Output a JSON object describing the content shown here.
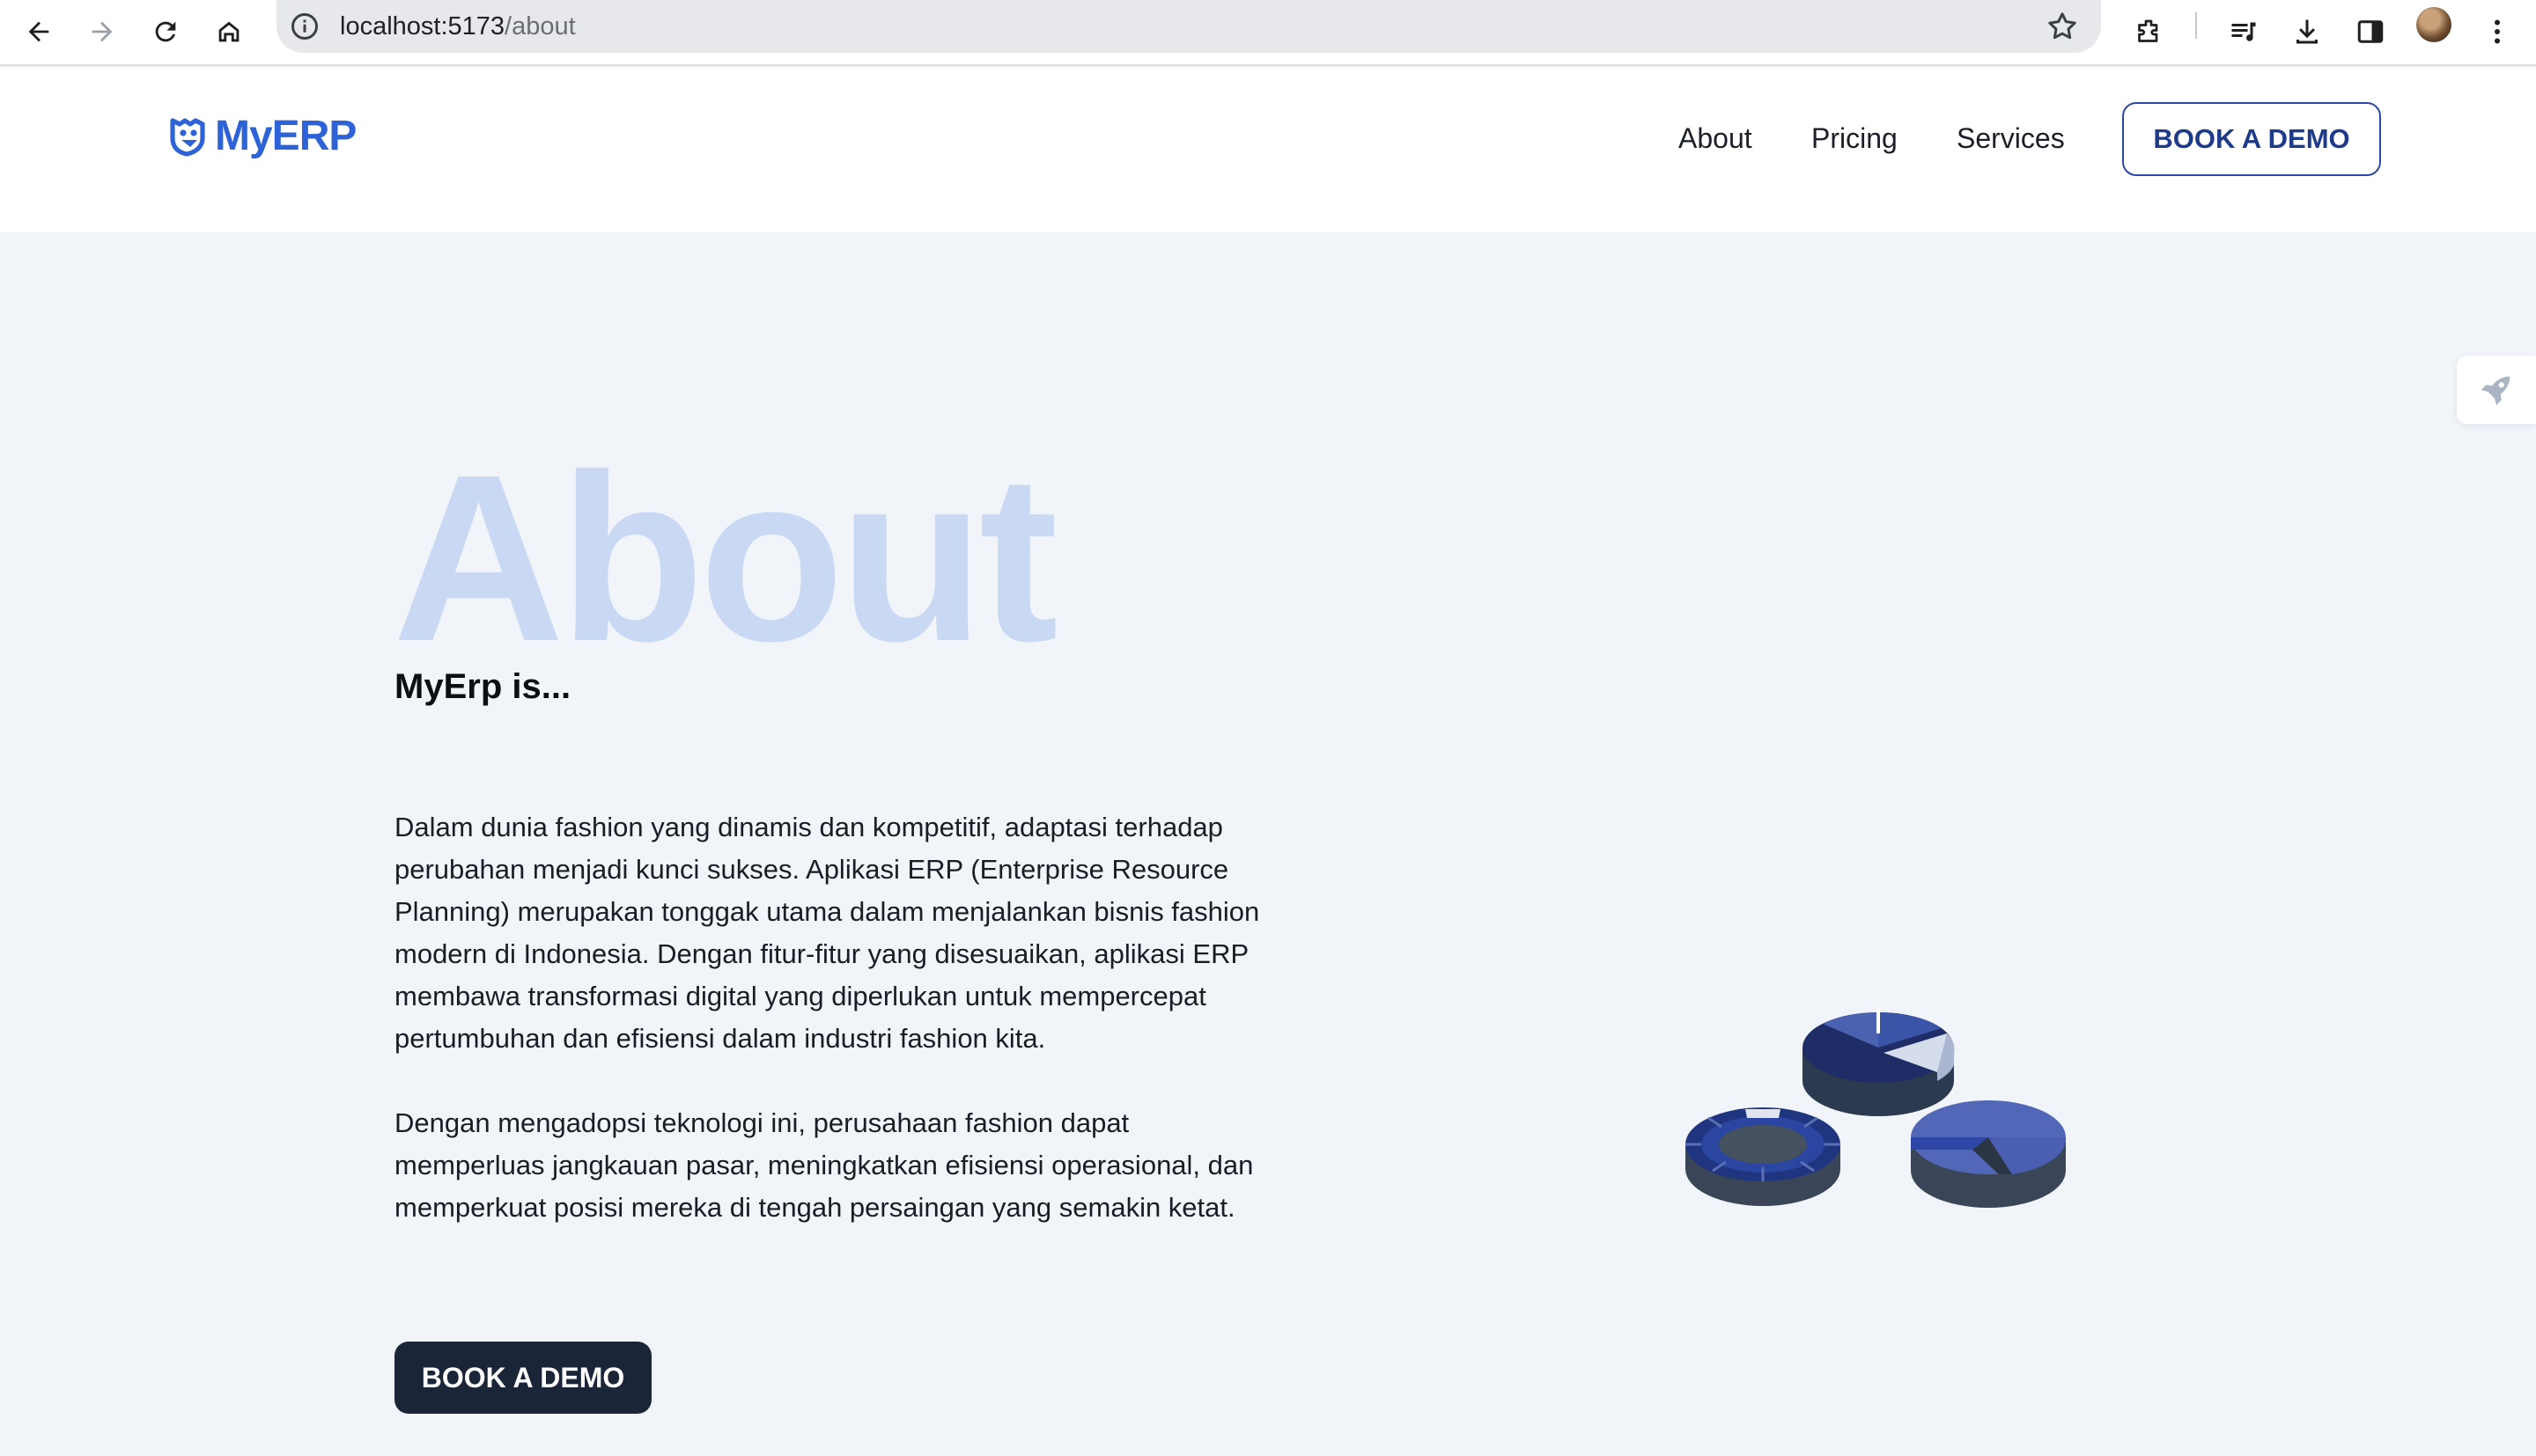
{
  "browser": {
    "url_host": "localhost:5173",
    "url_path": "/about",
    "icons": [
      "back-arrow-icon",
      "forward-arrow-icon",
      "reload-icon",
      "home-icon",
      "info-icon",
      "star-icon",
      "extensions-icon",
      "reading-list-icon",
      "download-icon",
      "side-panel-icon",
      "profile-avatar",
      "more-menu-icon"
    ]
  },
  "header": {
    "logo_text": "MyERP",
    "nav": [
      {
        "label": "About"
      },
      {
        "label": "Pricing"
      },
      {
        "label": "Services"
      }
    ],
    "cta_label": "BOOK A DEMO"
  },
  "hero": {
    "title": "About",
    "subtitle": "MyErp is...",
    "paragraphs": [
      "Dalam dunia fashion yang dinamis dan kompetitif, adaptasi terhadap perubahan menjadi kunci sukses. Aplikasi ERP (Enterprise Resource Planning) merupakan tonggak utama dalam menjalankan bisnis fashion modern di Indonesia. Dengan fitur-fitur yang disesuaikan, aplikasi ERP membawa transformasi digital yang diperlukan untuk mempercepat pertumbuhan dan efisiensi dalam industri fashion kita.",
      "Dengan mengadopsi teknologi ini, perusahaan fashion dapat memperluas jangkauan pasar, meningkatkan efisiensi operasional, dan memperkuat posisi mereka di tengah persaingan yang semakin ketat."
    ],
    "cta_label": "BOOK A DEMO"
  },
  "side_widget": {
    "icon": "rocket-icon"
  },
  "illustration": {
    "icon": "pie-charts-illustration"
  },
  "colors": {
    "brand_blue": "#2e63d8",
    "title_tint": "#c9d9f4",
    "page_bg": "#f1f5fa",
    "dark_button": "#1b2538",
    "outline_button": "#2a48a6"
  }
}
